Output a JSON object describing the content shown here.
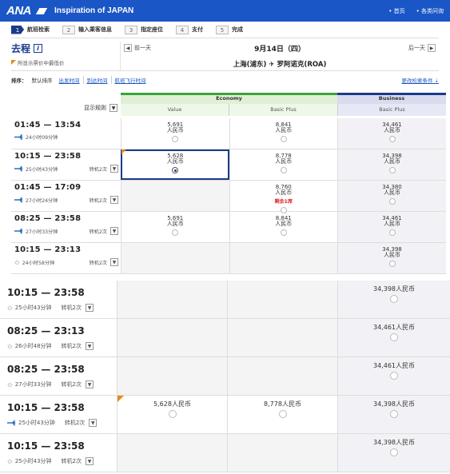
{
  "header": {
    "logo": "ANA",
    "tagline": "Inspiration of JAPAN",
    "links": [
      "首页",
      "各类问询"
    ]
  },
  "steps": [
    {
      "num": "1",
      "label": "航班检索",
      "active": true
    },
    {
      "num": "2",
      "label": "输入乘客信息"
    },
    {
      "num": "3",
      "label": "指定座位"
    },
    {
      "num": "4",
      "label": "支付"
    },
    {
      "num": "5",
      "label": "完成"
    }
  ],
  "trip": {
    "title": "去程",
    "help": "i",
    "lowest_note": "所显示票价中最低价",
    "prev_day": "前一天",
    "next_day": "后一天",
    "date": "9月14日（四）",
    "from": "上海(浦东)",
    "to": "罗阿诺克(ROA)"
  },
  "sort": {
    "label": "排序：",
    "current": "默认排序",
    "options": [
      "出发时间",
      "到达时间",
      "航班飞行时间"
    ],
    "change": "更改检索条件"
  },
  "table": {
    "display_rule": "显示规则",
    "cabins": {
      "economy": "Economy",
      "business": "Business"
    },
    "fares": {
      "value": "Value",
      "econ_basic": "Basic Plus",
      "biz_basic": "Basic Plus"
    },
    "currency": "人民币",
    "remaining": "剩余1席"
  },
  "rows": [
    {
      "time": "01:45 — 13:54",
      "duration": "24小时09分钟",
      "stops": "",
      "value": "5,691",
      "basic": "8,841",
      "biz": "34,461",
      "ana": true
    },
    {
      "time": "10:15 — 23:58",
      "duration": "25小时43分钟",
      "stops": "转机2次",
      "value": "5,628",
      "basic": "8,778",
      "biz": "34,398",
      "ana": true,
      "lowest": true,
      "selected": true
    },
    {
      "time": "01:45 — 17:09",
      "duration": "27小时24分钟",
      "stops": "转机2次",
      "value": "",
      "basic": "8,760",
      "biz": "34,380",
      "ana": true,
      "remain": true
    },
    {
      "time": "08:25 — 23:58",
      "duration": "27小时33分钟",
      "stops": "转机2次",
      "value": "5,691",
      "basic": "8,841",
      "biz": "34,461",
      "ana": true
    },
    {
      "time": "10:15 — 23:13",
      "duration": "24小时58分钟",
      "stops": "转机2次",
      "value": "",
      "basic": "",
      "biz": "34,398",
      "ana": false
    }
  ],
  "big_rows": [
    {
      "time": "10:15 — 23:58",
      "duration": "25小时43分钟",
      "stops": "转机2次",
      "value": "",
      "basic": "",
      "biz": "34,398",
      "ana": false
    },
    {
      "time": "08:25 — 23:13",
      "duration": "26小时48分钟",
      "stops": "转机2次",
      "value": "",
      "basic": "",
      "biz": "34,461",
      "ana": false
    },
    {
      "time": "08:25 — 23:58",
      "duration": "27小时33分钟",
      "stops": "转机2次",
      "value": "",
      "basic": "",
      "biz": "34,461",
      "ana": false
    },
    {
      "time": "10:15 — 23:58",
      "duration": "25小时43分钟",
      "stops": "转机2次",
      "value": "5,628",
      "basic": "8,778",
      "biz": "34,398",
      "ana": true,
      "lowest": true
    },
    {
      "time": "10:15 — 23:58",
      "duration": "25小时43分钟",
      "stops": "转机2次",
      "value": "",
      "basic": "",
      "biz": "34,398",
      "ana": false
    }
  ]
}
